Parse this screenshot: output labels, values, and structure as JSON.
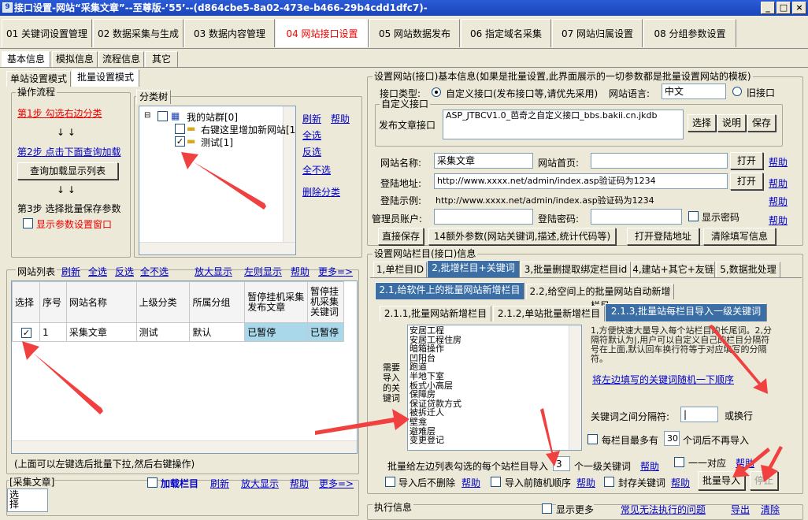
{
  "window": {
    "title": "接口设置-网站“采集文章”--至尊版-’55’--(d864cbe5-8a02-473e-b466-29b4cdd1dfc7)-"
  },
  "main_tabs": [
    "01 关键词设置管理",
    "02 数据采集与生成",
    "03 数据内容管理",
    "04 网站接口设置",
    "05 网站数据发布",
    "06 指定域名采集",
    "07 网站归属设置",
    "08 分组参数设置"
  ],
  "sub_tabs": [
    "基本信息",
    "模拟信息",
    "流程信息",
    "其它"
  ],
  "mode_tabs": [
    "单站设置模式",
    "批量设置模式"
  ],
  "flow": {
    "title": "操作流程",
    "step1": "第1步 勾选右边分类",
    "step2": "第2步 点击下面查询加载",
    "query_btn": "查询加载显示列表",
    "step3": "第3步 选择批量保存参数",
    "show_param": "显示参数设置窗口",
    "arrows": "↓ ↓"
  },
  "tree": {
    "title": "分类树",
    "root": "我的站群[0]",
    "item1": "右键这里增加新网站[1",
    "item2": "测试[1]",
    "links": [
      "刷新",
      "帮助",
      "全选",
      "反选",
      "全不选",
      "删除分类"
    ]
  },
  "site_list": {
    "label": "网站列表",
    "links": [
      "刷新",
      "全选",
      "反选",
      "全不选",
      "放大显示",
      "左则显示",
      "帮助",
      "更多=>"
    ],
    "headers": [
      "选择",
      "序号",
      "网站名称",
      "上级分类",
      "所属分组",
      "暂停挂机采集发布文章",
      "暂停挂机采集关键词"
    ],
    "rows": [
      {
        "check": "✓",
        "no": "1",
        "name": "采集文章",
        "parent": "测试",
        "group": "默认",
        "p1": "已暂停",
        "p2": "已暂停"
      }
    ],
    "hint": "(上面可以左键选后批量下拉,然后右键操作)"
  },
  "bottom_left": {
    "label": "[采集文章]",
    "load_col": "加载栏目",
    "links": [
      "刷新",
      "放大显示",
      "帮助",
      "更多=>"
    ],
    "text": "选择"
  },
  "basic": {
    "title": "设置网站(接口)基本信息(如果是批量设置,此界面展示的一切参数都是批量设置网站的模板)",
    "iface_type": "接口类型:",
    "custom_radio": "自定义接口(发布接口等,请优先采用)",
    "lang_label": "网站语言:",
    "lang": "中文",
    "old_radio": "旧接口",
    "custom_group": "自定义接口",
    "publish_label": "发布文章接口",
    "publish_value": "ASP_JTBCV1.0_芭奇之自定义接口_bbs.bakii.cn.jkdb",
    "btns": [
      "选择",
      "说明",
      "保存"
    ],
    "site_name_label": "网站名称:",
    "site_name": "采集文章",
    "home_label": "网站首页:",
    "open": "打开",
    "help": "帮助",
    "login_label": "登陆地址:",
    "login_url": "http://www.xxxx.net/admin/index.asp验证码为1234",
    "example_label": "登陆示例:",
    "example": "http://www.xxxx.net/admin/index.asp验证码为1234",
    "admin_label": "管理员账户:",
    "pwd_label": "登陆密码:",
    "show_pwd": "显示密码",
    "action_btns": [
      "直接保存",
      "14额外参数(网站关键词,描述,统计代码等)",
      "打开登陆地址",
      "清除填写信息"
    ]
  },
  "column": {
    "title": "设置网站栏目(接口)信息",
    "tabs": [
      "1,单栏目ID",
      "2,批增栏目+关键词",
      "3,批量删提取绑定栏目id",
      "4,建站+其它+友链",
      "5,数据批处理"
    ],
    "subtabs": [
      "2.1,给软件上的批量网站新增栏目",
      "2.2,给空间上的批量网站自动新增栏目"
    ],
    "subsub": [
      "2.1.1,批量网站新增栏目",
      "2.1.2,单站批量新增栏目",
      "2.1.3,批量站每栏目导入一级关键词"
    ],
    "side_label": "需要导入的关键词",
    "keywords": [
      "安居工程",
      "安居工程住房",
      "暗箱操作",
      "凹阳台",
      "跑道",
      "半地下室",
      "板式小高层",
      "保障房",
      "保证贷款方式",
      "被拆迁人",
      "壁龛",
      "避难层",
      "变更登记"
    ],
    "note": "1,方便快速大量导入每个站栏目的长尾词。2,分隔符默认为|,用户可以自定义自己的栏目分隔符号在上面,默认回车换行符等于对应填写的分隔符。",
    "random_link": "将左边填写的关键词随机一下顺序",
    "sep_label": "关键词之间分隔符:",
    "sep_value": "|",
    "or_newline": "或换行",
    "max_label": "每栏目最多有",
    "max_value": "30",
    "max_suffix": "个词后不再导入",
    "import_label": "批量给左边列表勾选的每个站栏目导入",
    "import_value": "3",
    "import_suffix": "个一级关键词",
    "one_to_one": "一一对应",
    "no_delete": "导入后不删除",
    "random_order": "导入前随机顺序",
    "seal": "封存关键词",
    "import_btn": "批量导入",
    "stop_btn": "停止",
    "help": "帮助"
  },
  "exec": {
    "title": "执行信息",
    "show_more": "显示更多",
    "faq": "常见无法执行的问题",
    "export": "导出",
    "clear": "清除"
  },
  "colors": {
    "accent_red": "#e00000",
    "link": "#0000cc",
    "title": "#1a44b8",
    "arrow": "#f04040"
  }
}
